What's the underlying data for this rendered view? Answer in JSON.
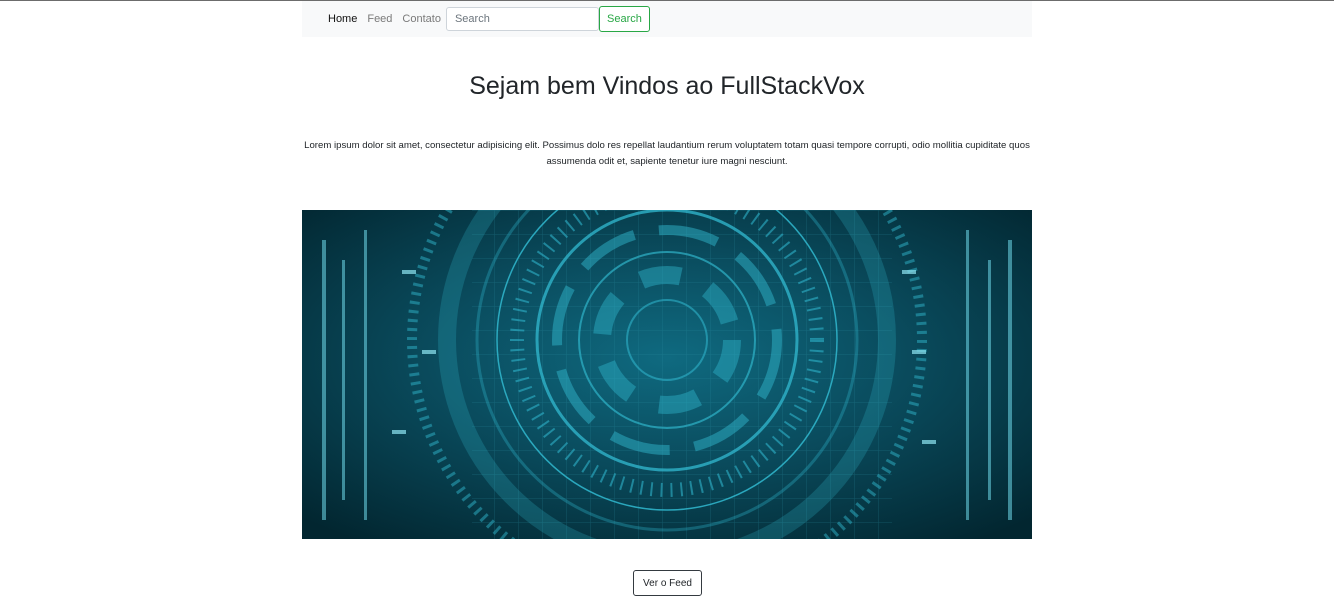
{
  "nav": {
    "links": [
      {
        "label": "Home",
        "active": true
      },
      {
        "label": "Feed",
        "active": false
      },
      {
        "label": "Contato",
        "active": false
      }
    ],
    "search": {
      "placeholder": "Search",
      "button_label": "Search"
    }
  },
  "main": {
    "title": "Sejam bem Vindos ao FullStackVox",
    "lead": "Lorem ipsum dolor sit amet, consectetur adipisicing elit. Possimus dolo res repellat laudantium rerum voluptatem totam quasi tempore corrupti, odio mollitia cupiditate quos assumenda odit et, sapiente tenetur iure magni nesciunt.",
    "feed_button_label": "Ver o Feed"
  },
  "colors": {
    "accent_green": "#28a745",
    "navbar_bg": "#f8f9fa",
    "hero_dark": "#04303c",
    "hero_glow": "#2fb3c9"
  },
  "icons": {
    "hero_image": "technology-circuit-hud-image"
  }
}
